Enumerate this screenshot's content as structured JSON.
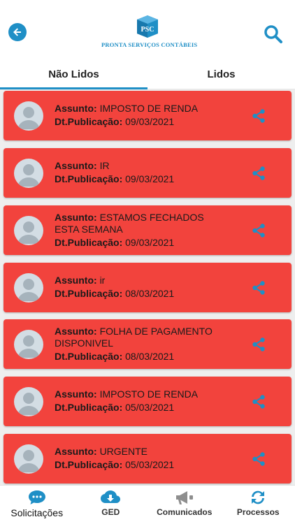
{
  "header": {
    "brand": "PRONTA SERVIÇOS CONTÁBEIS",
    "logo_mark": "PSC",
    "back_icon": "arrow-left-icon",
    "search_icon": "search-icon",
    "accent_color": "#1f8fc6"
  },
  "tabs": [
    {
      "label": "Não Lidos",
      "active": true
    },
    {
      "label": "Lidos",
      "active": false
    }
  ],
  "labels": {
    "subject": "Assunto:",
    "published": "Dt.Publicação:"
  },
  "messages": [
    {
      "subject_lines": [
        "IMPOSTO DE RENDA"
      ],
      "date": "09/03/2021"
    },
    {
      "subject_lines": [
        "IR"
      ],
      "date": "09/03/2021"
    },
    {
      "subject_lines": [
        "ESTAMOS FECHADOS",
        "ESTA SEMANA"
      ],
      "date": "09/03/2021"
    },
    {
      "subject_lines": [
        "ir"
      ],
      "date": "08/03/2021"
    },
    {
      "subject_lines": [
        "FOLHA DE PAGAMENTO",
        "DISPONIVEL"
      ],
      "date": "08/03/2021"
    },
    {
      "subject_lines": [
        "IMPOSTO DE RENDA"
      ],
      "date": "05/03/2021"
    },
    {
      "subject_lines": [
        "URGENTE"
      ],
      "date": "05/03/2021"
    }
  ],
  "card_color": "#f2433d",
  "bottom_nav": [
    {
      "label": "Solicitações",
      "icon": "chat-bubble-icon",
      "active": true
    },
    {
      "label": "GED",
      "icon": "cloud-download-icon",
      "active": false
    },
    {
      "label": "Comunicados",
      "icon": "megaphone-icon",
      "active": false
    },
    {
      "label": "Processos",
      "icon": "refresh-icon",
      "active": false
    }
  ]
}
